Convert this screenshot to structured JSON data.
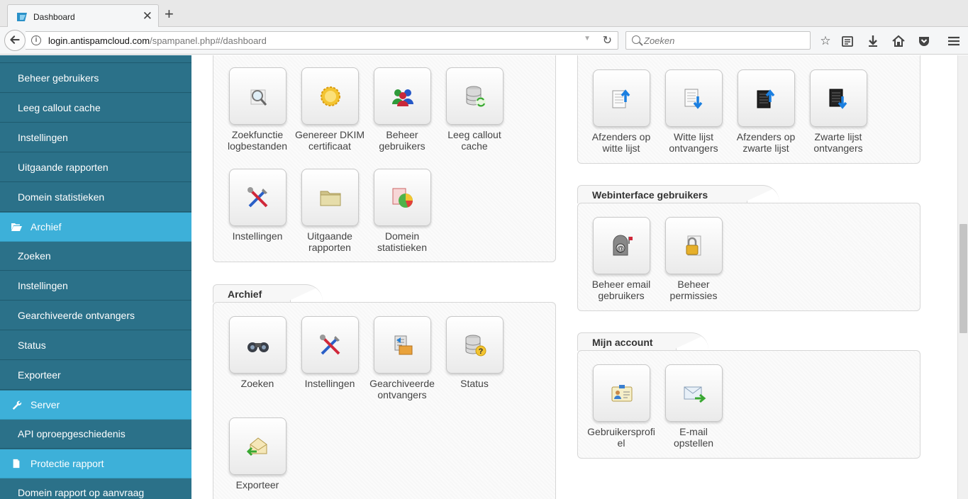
{
  "browser": {
    "tab_title": "Dashboard",
    "url_domain": "login.antispamcloud.com",
    "url_path": "/spampanel.php#/dashboard",
    "search_placeholder": "Zoeken"
  },
  "sidebar": {
    "items": [
      {
        "label": "Beheer gebruikers",
        "section": false
      },
      {
        "label": "Leeg callout cache",
        "section": false
      },
      {
        "label": "Instellingen",
        "section": false
      },
      {
        "label": "Uitgaande rapporten",
        "section": false
      },
      {
        "label": "Domein statistieken",
        "section": false
      },
      {
        "label": "Archief",
        "section": true,
        "icon": "folder-open-icon"
      },
      {
        "label": "Zoeken",
        "section": false
      },
      {
        "label": "Instellingen",
        "section": false
      },
      {
        "label": "Gearchiveerde ontvangers",
        "section": false
      },
      {
        "label": "Status",
        "section": false
      },
      {
        "label": "Exporteer",
        "section": false
      },
      {
        "label": "Server",
        "section": true,
        "icon": "wrench-icon"
      },
      {
        "label": "API oproepgeschiedenis",
        "section": false
      },
      {
        "label": "Protectie rapport",
        "section": true,
        "icon": "document-icon"
      },
      {
        "label": "Domein rapport op aanvraag",
        "section": false
      }
    ]
  },
  "panels": {
    "top_left": {
      "tiles": [
        {
          "line1": "Zoekfunctie",
          "line2": "logbestanden",
          "icon": "magnifier-icon"
        },
        {
          "line1": "Genereer DKIM",
          "line2": "certificaat",
          "icon": "certificate-seal-icon"
        },
        {
          "line1": "Beheer",
          "line2": "gebruikers",
          "icon": "users-icon"
        },
        {
          "line1": "Leeg callout",
          "line2": "cache",
          "icon": "database-refresh-icon"
        },
        {
          "line1": "Instellingen",
          "line2": "",
          "icon": "tools-icon"
        },
        {
          "line1": "Uitgaande",
          "line2": "rapporten",
          "icon": "folder-icon"
        },
        {
          "line1": "Domein",
          "line2": "statistieken",
          "icon": "pie-chart-icon"
        }
      ]
    },
    "archief": {
      "title": "Archief",
      "tiles": [
        {
          "line1": "Zoeken",
          "line2": "",
          "icon": "binoculars-icon"
        },
        {
          "line1": "Instellingen",
          "line2": "",
          "icon": "tools-icon"
        },
        {
          "line1": "Gearchiveerde",
          "line2": "ontvangers",
          "icon": "archive-recipients-icon"
        },
        {
          "line1": "Status",
          "line2": "",
          "icon": "database-help-icon"
        },
        {
          "line1": "Exporteer",
          "line2": "",
          "icon": "mail-export-icon"
        }
      ]
    },
    "top_right": {
      "tiles": [
        {
          "line1": "Afzenders op",
          "line2": "witte lijst",
          "icon": "whitelist-up-icon"
        },
        {
          "line1": "Witte lijst",
          "line2": "ontvangers",
          "icon": "whitelist-down-icon"
        },
        {
          "line1": "Afzenders op",
          "line2": "zwarte lijst",
          "icon": "blacklist-up-icon"
        },
        {
          "line1": "Zwarte lijst",
          "line2": "ontvangers",
          "icon": "blacklist-down-icon"
        }
      ]
    },
    "webinterface": {
      "title": "Webinterface gebruikers",
      "tiles": [
        {
          "line1": "Beheer email",
          "line2": "gebruikers",
          "icon": "mailbox-icon"
        },
        {
          "line1": "Beheer",
          "line2": "permissies",
          "icon": "lock-document-icon"
        }
      ]
    },
    "mijn_account": {
      "title": "Mijn account",
      "tiles": [
        {
          "line1": "Gebruikersprofi",
          "line2": "el",
          "icon": "id-card-icon"
        },
        {
          "line1": "E-mail",
          "line2": "opstellen",
          "icon": "compose-mail-icon"
        }
      ]
    }
  }
}
